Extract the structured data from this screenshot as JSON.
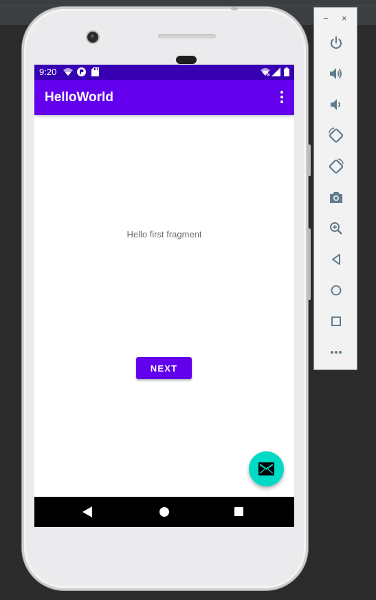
{
  "status_bar": {
    "time": "9:20",
    "left_icons": [
      "wifi-icon",
      "game-icon",
      "sd-card-icon"
    ],
    "right_icons": [
      "wifi-icon",
      "signal-icon",
      "battery-icon"
    ]
  },
  "app_bar": {
    "title": "HelloWorld",
    "menu_icon": "more-vert-icon"
  },
  "content": {
    "text": "Hello first fragment",
    "button_label": "NEXT"
  },
  "fab": {
    "icon": "email-icon",
    "color": "#03dac5"
  },
  "navigation_bar": {
    "icons": [
      "back-icon",
      "home-icon",
      "recents-icon"
    ]
  },
  "emulator_toolbar": {
    "window_controls": [
      "−",
      "×"
    ],
    "tools": [
      "power-icon",
      "volume-up-icon",
      "volume-down-icon",
      "rotate-left-icon",
      "rotate-right-icon",
      "screenshot-icon",
      "zoom-icon",
      "back-icon",
      "home-icon",
      "overview-icon",
      "more-icon"
    ]
  },
  "colors": {
    "primary": "#6200ee",
    "primary_dark": "#3700b3",
    "accent": "#03dac5"
  }
}
